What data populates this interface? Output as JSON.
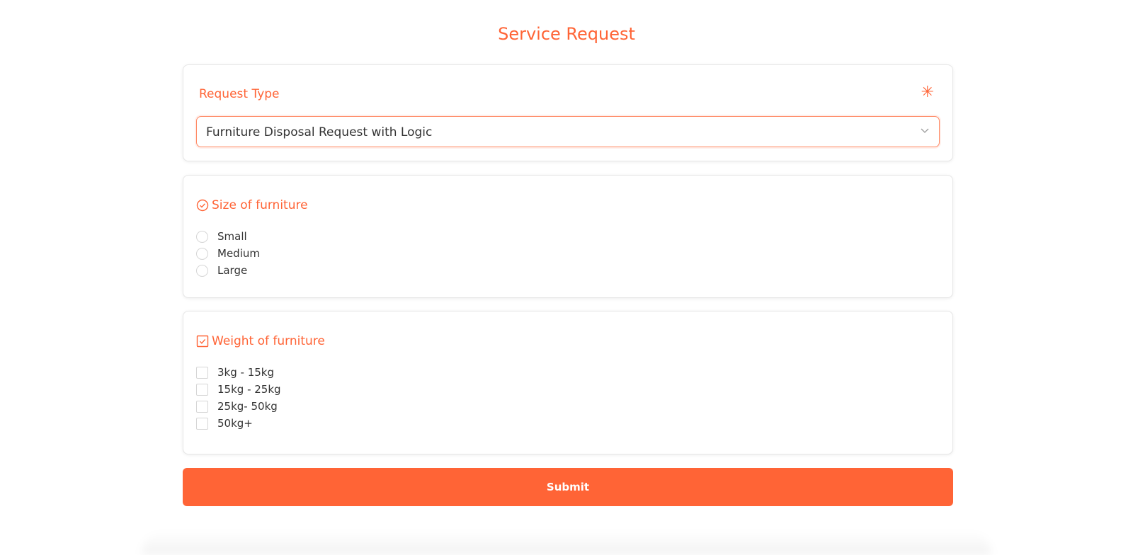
{
  "page": {
    "title": "Service Request"
  },
  "request_type": {
    "label": "Request Type",
    "required_marker": "✳",
    "selected_value": "Furniture Disposal Request with Logic",
    "dropdown_icon": "chevron-down-icon"
  },
  "size_section": {
    "icon": "check-circle-icon",
    "label": "Size of furniture",
    "options": [
      "Small",
      "Medium",
      "Large"
    ]
  },
  "weight_section": {
    "icon": "check-square-icon",
    "label": "Weight of furniture",
    "options": [
      "3kg - 15kg",
      "15kg - 25kg",
      "25kg- 50kg",
      "50kg+"
    ]
  },
  "submit": {
    "label": "Submit"
  },
  "colors": {
    "accent": "#FF6436",
    "text": "#333333",
    "border": "#e6e6e6"
  }
}
